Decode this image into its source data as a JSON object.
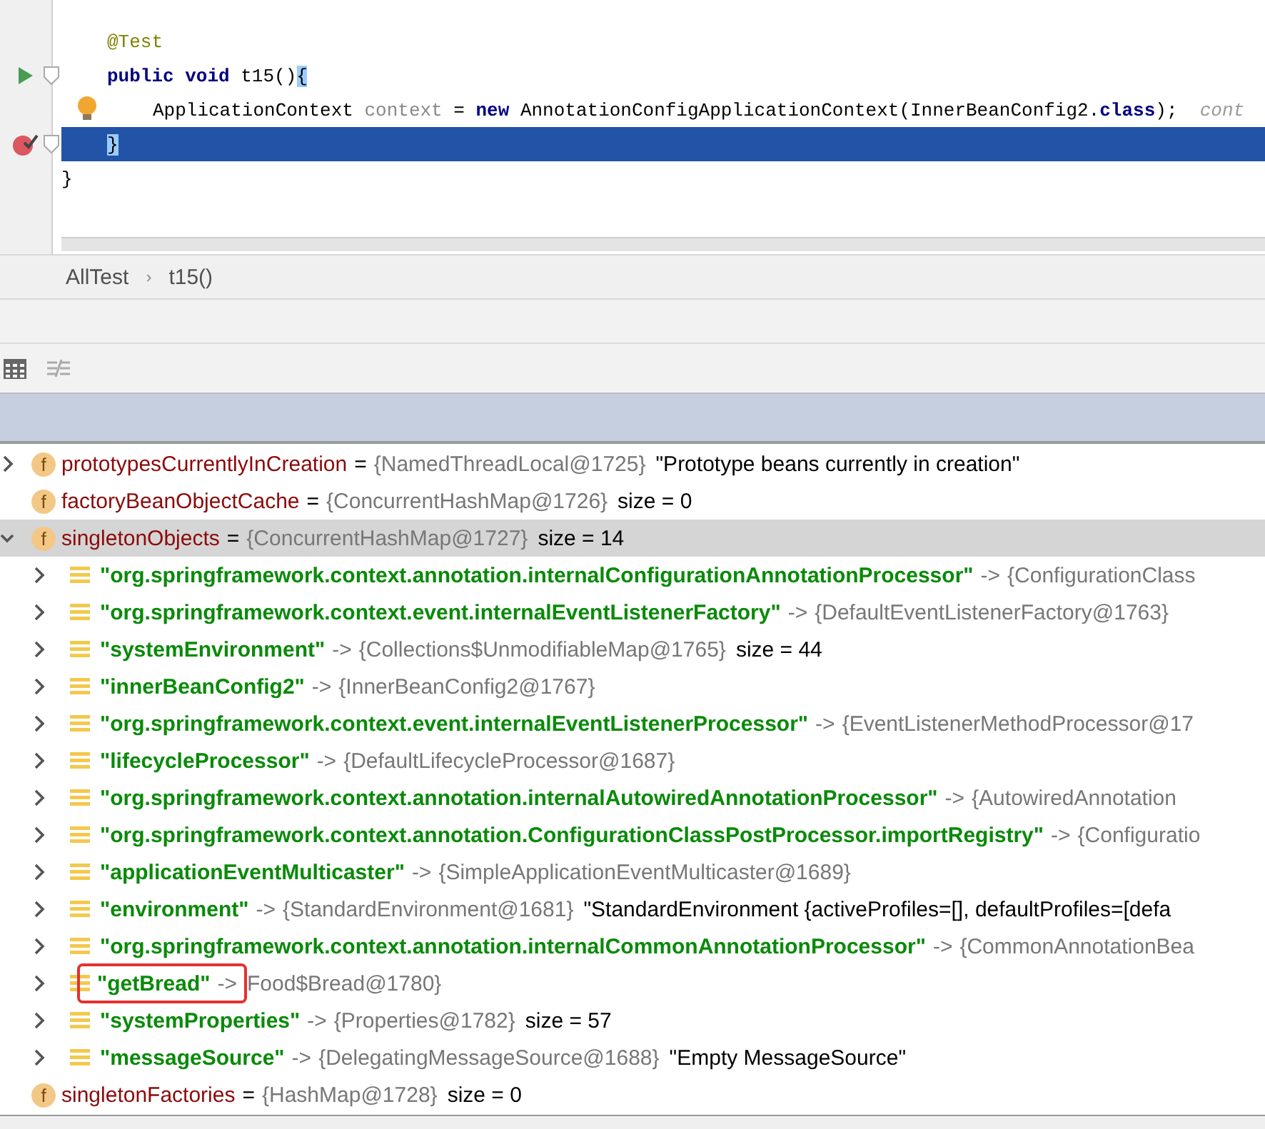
{
  "editor": {
    "body": [
      {
        "run_marker": false,
        "intention_bulb": false,
        "breakpoint": false,
        "fold": false,
        "current": false,
        "tokens": [
          {
            "kind": "annotation",
            "text": "@Test"
          }
        ]
      },
      {
        "run_marker": true,
        "intention_bulb": false,
        "breakpoint": false,
        "fold": true,
        "current": false,
        "tokens": [
          {
            "kind": "keyword",
            "text": "public void"
          },
          {
            "kind": "plain",
            "text": " t15()"
          },
          {
            "kind": "brace",
            "text": "{"
          }
        ],
        "children": [
          {
            "run_marker": false,
            "intention_bulb": true,
            "breakpoint": false,
            "fold": false,
            "current": false,
            "tokens": [
              {
                "kind": "plain",
                "text": "ApplicationContext "
              },
              {
                "kind": "variable",
                "text": "context"
              },
              {
                "kind": "plain",
                "text": " = "
              },
              {
                "kind": "keyword",
                "text": "new"
              },
              {
                "kind": "plain",
                "text": " AnnotationConfigApplicationContext(InnerBeanConfig2."
              },
              {
                "kind": "keyword",
                "text": "class"
              },
              {
                "kind": "plain",
                "text": ");  "
              },
              {
                "kind": "comment",
                "text": "cont"
              }
            ]
          }
        ]
      },
      {
        "run_marker": false,
        "intention_bulb": false,
        "breakpoint": true,
        "fold": true,
        "current": true,
        "tokens": [
          {
            "kind": "brace",
            "text": "}"
          }
        ]
      }
    ],
    "closing_line": {
      "run_marker": false,
      "intention_bulb": false,
      "breakpoint": false,
      "fold": false,
      "current": false,
      "tokens": [
        {
          "kind": "plain",
          "text": "}"
        }
      ]
    }
  },
  "breadcrumb": [
    "AllTest",
    "›",
    "t15()"
  ],
  "variables": [
    {
      "kind": "field",
      "icon": "f",
      "expandable": true,
      "expanded": false,
      "selected": false,
      "name": "prototypesCurrentlyInCreation",
      "separator": "=",
      "value": "{NamedThreadLocal@1725}",
      "extra": "\"Prototype beans currently in creation\""
    },
    {
      "kind": "field",
      "icon": "f",
      "expandable": false,
      "expanded": false,
      "selected": false,
      "name": "factoryBeanObjectCache",
      "separator": "=",
      "value": "{ConcurrentHashMap@1726}",
      "extra": "size = 0"
    },
    {
      "kind": "field",
      "icon": "f",
      "expandable": true,
      "expanded": true,
      "selected": true,
      "name": "singletonObjects",
      "separator": "=",
      "value": "{ConcurrentHashMap@1727}",
      "extra": "size = 14",
      "children": [
        {
          "kind": "entry",
          "highlighted": false,
          "key": "\"org.springframework.context.annotation.internalConfigurationAnnotationProcessor\"",
          "arrow": "->",
          "value": "{ConfigurationClass"
        },
        {
          "kind": "entry",
          "highlighted": false,
          "key": "\"org.springframework.context.event.internalEventListenerFactory\"",
          "arrow": "->",
          "value": "{DefaultEventListenerFactory@1763}"
        },
        {
          "kind": "entry",
          "highlighted": false,
          "key": "\"systemEnvironment\"",
          "arrow": "->",
          "value": "{Collections$UnmodifiableMap@1765}",
          "extra": "size = 44"
        },
        {
          "kind": "entry",
          "highlighted": false,
          "key": "\"innerBeanConfig2\"",
          "arrow": "->",
          "value": "{InnerBeanConfig2@1767}"
        },
        {
          "kind": "entry",
          "highlighted": false,
          "key": "\"org.springframework.context.event.internalEventListenerProcessor\"",
          "arrow": "->",
          "value": "{EventListenerMethodProcessor@17"
        },
        {
          "kind": "entry",
          "highlighted": false,
          "key": "\"lifecycleProcessor\"",
          "arrow": "->",
          "value": "{DefaultLifecycleProcessor@1687}"
        },
        {
          "kind": "entry",
          "highlighted": false,
          "key": "\"org.springframework.context.annotation.internalAutowiredAnnotationProcessor\"",
          "arrow": "->",
          "value": "{AutowiredAnnotation"
        },
        {
          "kind": "entry",
          "highlighted": false,
          "key": "\"org.springframework.context.annotation.ConfigurationClassPostProcessor.importRegistry\"",
          "arrow": "->",
          "value": "{Configuratio"
        },
        {
          "kind": "entry",
          "highlighted": false,
          "key": "\"applicationEventMulticaster\"",
          "arrow": "->",
          "value": "{SimpleApplicationEventMulticaster@1689}"
        },
        {
          "kind": "entry",
          "highlighted": false,
          "key": "\"environment\"",
          "arrow": "->",
          "value": "{StandardEnvironment@1681}",
          "extra": "\"StandardEnvironment {activeProfiles=[], defaultProfiles=[defa"
        },
        {
          "kind": "entry",
          "highlighted": false,
          "key": "\"org.springframework.context.annotation.internalCommonAnnotationProcessor\"",
          "arrow": "->",
          "value": "{CommonAnnotationBea"
        },
        {
          "kind": "entry",
          "highlighted": true,
          "key": "\"getBread\"",
          "arrow": "->",
          "value": "Food$Bread@1780}"
        },
        {
          "kind": "entry",
          "highlighted": false,
          "key": "\"systemProperties\"",
          "arrow": "->",
          "value": "{Properties@1782}",
          "extra": "size = 57"
        },
        {
          "kind": "entry",
          "highlighted": false,
          "key": "\"messageSource\"",
          "arrow": "->",
          "value": "{DelegatingMessageSource@1688}",
          "extra": "\"Empty MessageSource\""
        }
      ]
    },
    {
      "kind": "field",
      "icon": "f",
      "expandable": false,
      "expanded": false,
      "selected": false,
      "name": "singletonFactories",
      "separator": "=",
      "value": "{HashMap@1728}",
      "extra": "size = 0"
    }
  ]
}
